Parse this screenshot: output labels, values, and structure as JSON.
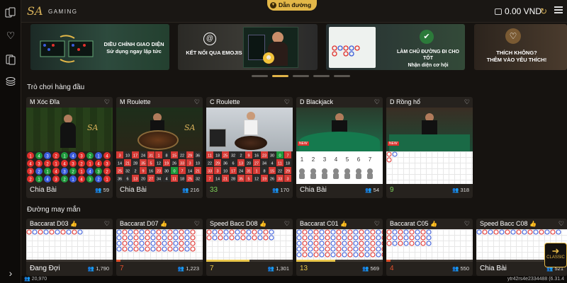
{
  "header": {
    "brand": "GAMING",
    "guide_label": "Dẫn đường",
    "balance": "0.00 VND"
  },
  "banners": [
    {
      "text": "DIỀU CHỈNH GIAO DIỆN\nSử dụng ngay lập tức"
    },
    {
      "text": "KẾT NỐI QUA EMOJIS"
    },
    {
      "text": "LÀM CHỦ ĐƯỜNG ĐI CHO TỐT\nNhận diện cơ hội"
    },
    {
      "text": "THÍCH KHÔNG?\nTHÊM VÀO YÊU THÍCH!"
    }
  ],
  "sections": {
    "top_games": "Trò chơi hàng đầu",
    "lucky_roads": "Đường may mắn"
  },
  "top_games": [
    {
      "title": "M Xóc Đĩa",
      "status": "Chia Bài",
      "count": "59"
    },
    {
      "title": "M Roulette",
      "status": "Chia Bài",
      "count": "216"
    },
    {
      "title": "C Roulette",
      "status": "33",
      "count": "170",
      "status_color": "#7fd25a"
    },
    {
      "title": "D Blackjack",
      "status": "Chia Bài",
      "count": "54"
    },
    {
      "title": "D Rồng hổ",
      "status": "9",
      "count": "318",
      "status_color": "#7fd25a"
    }
  ],
  "roads": [
    {
      "title": "Baccarat D03",
      "status": "Đang Đợi",
      "count": "1,790",
      "status_color": "#ffffff",
      "progress": 0
    },
    {
      "title": "Baccarat D07",
      "status": "7",
      "count": "1,223",
      "status_color": "#e0502c",
      "progress": 0.05
    },
    {
      "title": "Speed Bacc D08",
      "status": "7",
      "count": "1,301",
      "status_color": "#e9c64a",
      "progress": 0.5
    },
    {
      "title": "Baccarat C01",
      "status": "13",
      "count": "569",
      "status_color": "#e9c64a",
      "progress": 0.45
    },
    {
      "title": "Baccarat C05",
      "status": "4",
      "count": "550",
      "status_color": "#e0502c",
      "progress": 0.05
    },
    {
      "title": "Speed Bacc C08",
      "status": "Chia Bài",
      "count": "521",
      "status_color": "#ffffff",
      "progress": 0
    }
  ],
  "footer": {
    "online": "20,970",
    "version": "ytr42rs4e2334488 (6.31.4"
  },
  "classic_label": "CLASSIC",
  "colors": {
    "accent": "#e3b748",
    "player": "#3a5bd9",
    "banker": "#e0302c"
  }
}
